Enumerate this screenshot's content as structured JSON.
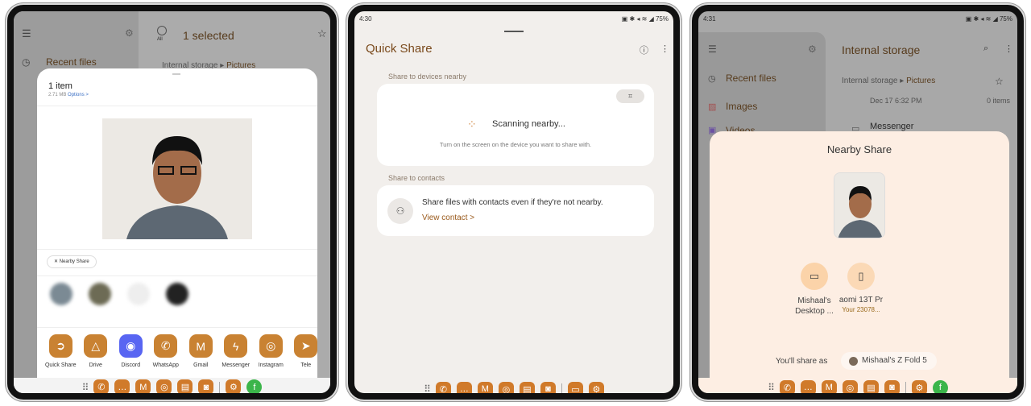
{
  "phone1": {
    "header": {
      "select_all": "All",
      "title": "1 selected"
    },
    "sidebar": {
      "recent": "Recent files"
    },
    "breadcrumb": {
      "root": "Internal storage",
      "current": "Pictures"
    },
    "sheet": {
      "title": "1 item",
      "size": "2.71 MB",
      "options": "Options >",
      "nearby_share": "Nearby Share",
      "apps": [
        {
          "label": "Quick Share",
          "icon": "quick-share-icon"
        },
        {
          "label": "Drive",
          "icon": "drive-icon"
        },
        {
          "label": "Discord",
          "icon": "discord-icon",
          "color": "#5865f2"
        },
        {
          "label": "WhatsApp",
          "icon": "whatsapp-icon"
        },
        {
          "label": "Gmail",
          "icon": "gmail-icon"
        },
        {
          "label": "Messenger",
          "icon": "messenger-icon"
        },
        {
          "label": "Instagram",
          "icon": "instagram-icon"
        },
        {
          "label": "Tele",
          "icon": "telegram-icon"
        }
      ]
    }
  },
  "phone2": {
    "status": {
      "time": "4:30",
      "battery": "75%"
    },
    "title": "Quick Share",
    "devices_section": "Share to devices nearby",
    "scanning": "Scanning nearby...",
    "scan_hint": "Turn on the screen on the device you want to share with.",
    "contacts_section": "Share to contacts",
    "contacts_text": "Share files with contacts even if they're not nearby.",
    "view_contact": "View contact >"
  },
  "phone3": {
    "status": {
      "time": "4:31",
      "battery": "75%"
    },
    "title": "Internal storage",
    "sidebar": {
      "recent": "Recent files",
      "images": "Images",
      "videos": "Videos"
    },
    "breadcrumb": {
      "root": "Internal storage",
      "current": "Pictures"
    },
    "list": [
      {
        "date": "Dec 17 6:32 PM",
        "count": "0 items"
      },
      {
        "name": "Messenger"
      }
    ],
    "sheet": {
      "title": "Nearby Share",
      "devices": [
        {
          "name": "Mishaal's Desktop ...",
          "sub": "",
          "icon": "laptop-icon"
        },
        {
          "name": "aomi 13T Pr",
          "sub": "Your 23078...",
          "icon": "phone-icon"
        }
      ],
      "share_as_label": "You'll share as",
      "share_as_name": "Mishaal's Z Fold 5"
    }
  },
  "colors": {
    "accent": "#c98232",
    "title_brown": "#7a4a1c",
    "sheet_peach": "#fdeee3"
  }
}
